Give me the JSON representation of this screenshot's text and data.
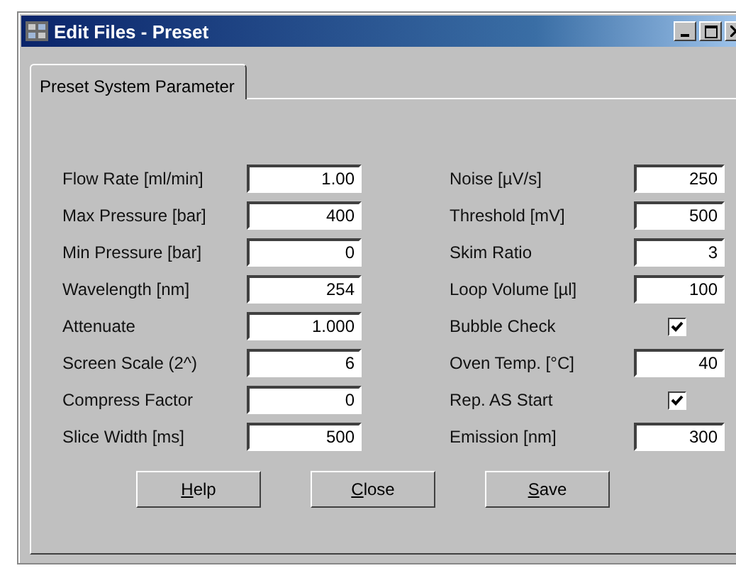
{
  "window": {
    "title": "Edit Files - Preset"
  },
  "tabs": [
    {
      "label": "Preset System Parameter",
      "selected": true
    }
  ],
  "columns": [
    {
      "rows": [
        {
          "kind": "field",
          "label": "Flow Rate [ml/min]",
          "value": "1.00"
        },
        {
          "kind": "field",
          "label": "Max Pressure [bar]",
          "value": "400"
        },
        {
          "kind": "field",
          "label": "Min Pressure [bar]",
          "value": "0"
        },
        {
          "kind": "field",
          "label": "Wavelength [nm]",
          "value": "254"
        },
        {
          "kind": "field",
          "label": "Attenuate",
          "value": "1.000"
        },
        {
          "kind": "field",
          "label": "Screen Scale (2^)",
          "value": "6"
        },
        {
          "kind": "field",
          "label": "Compress Factor",
          "value": "0"
        },
        {
          "kind": "field",
          "label": "Slice Width [ms]",
          "value": "500"
        }
      ]
    },
    {
      "rows": [
        {
          "kind": "field",
          "label": "Noise [µV/s]",
          "value": "250"
        },
        {
          "kind": "field",
          "label": "Threshold [mV]",
          "value": "500"
        },
        {
          "kind": "field",
          "label": "Skim Ratio",
          "value": "3"
        },
        {
          "kind": "field",
          "label": "Loop Volume [µl]",
          "value": "100"
        },
        {
          "kind": "checkbox",
          "label": "Bubble Check",
          "checked": true
        },
        {
          "kind": "field",
          "label": "Oven Temp. [°C]",
          "value": "40"
        },
        {
          "kind": "checkbox",
          "label": "Rep. AS Start",
          "checked": true
        },
        {
          "kind": "field",
          "label": "Emission [nm]",
          "value": "300"
        }
      ]
    }
  ],
  "buttons": [
    {
      "key": "H",
      "rest": "elp"
    },
    {
      "key": "C",
      "rest": "lose"
    },
    {
      "key": "S",
      "rest": "ave"
    }
  ]
}
